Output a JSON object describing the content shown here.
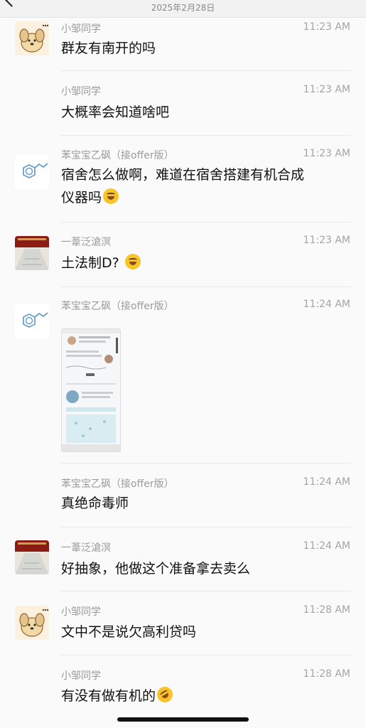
{
  "header": {
    "date": "2025年2月28日"
  },
  "messages": [
    {
      "sender": "小邹同学",
      "time": "11:23 AM",
      "text": "群友有南开的吗",
      "avatar": "dog-avatar"
    },
    {
      "sender": "小邹同学",
      "time": "11:23 AM",
      "text": "大概率会知道啥吧"
    },
    {
      "sender": "苯宝宝乙砜（接offer版）",
      "time": "11:23 AM",
      "line1": "宿舍怎么做啊，难道在宿舍搭建有机合成",
      "line2": "仪器吗",
      "avatar": "benzene-avatar",
      "emoji": "laughing-crying-emoji"
    },
    {
      "sender": "一葦泛滄溟",
      "time": "11:23 AM",
      "text": "土法制D?",
      "avatar": "palace-avatar",
      "emoji": "laughing-crying-emoji"
    },
    {
      "sender": "苯宝宝乙砜（接offer版）",
      "time": "11:24 AM",
      "avatar": "benzene-avatar",
      "image": "screenshot-thumbnail"
    },
    {
      "sender": "苯宝宝乙砜（接offer版）",
      "time": "11:24 AM",
      "text": "真绝命毒师"
    },
    {
      "sender": "一葦泛滄溟",
      "time": "11:24 AM",
      "text": "好抽象，他做这个准备拿去卖么",
      "avatar": "palace-avatar"
    },
    {
      "sender": "小邹同学",
      "time": "11:28 AM",
      "text": "文中不是说欠高利贷吗",
      "avatar": "dog-avatar"
    },
    {
      "sender": "小邹同学",
      "time": "11:28 AM",
      "text": "有没有做有机的",
      "emoji": "rolling-laughing-emoji"
    }
  ]
}
